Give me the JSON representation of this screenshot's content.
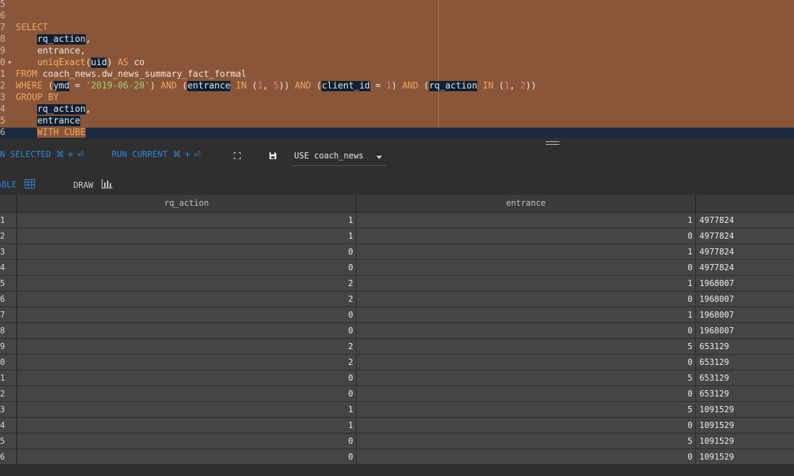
{
  "editor": {
    "line_numbers": [
      "5",
      "6",
      "7",
      "8",
      "9",
      "0",
      "1",
      "2",
      "3",
      "4",
      "5",
      "6"
    ],
    "sql": {
      "select": "SELECT",
      "col1": "rq_action",
      "col2": "entrance",
      "agg_fn": "uniqExact",
      "agg_arg": "uid",
      "as_kw": "AS",
      "alias": "co",
      "from_kw": "FROM",
      "table": "coach_news.dw_news_summary_fact_formal",
      "where_kw": "WHERE",
      "ymd": "ymd",
      "ymd_val": "'2019-06-20'",
      "and": "AND",
      "in": "IN",
      "entrance": "entrance",
      "client_id": "client_id",
      "rq_action": "rq_action",
      "n1": "1",
      "n2": "2",
      "n5": "5",
      "group_kw": "GROUP BY",
      "with_cube": "WITH CUBE"
    }
  },
  "toolbar": {
    "run_selected_label": "N SELECTED",
    "run_current_label": "RUN CURRENT",
    "shortcut": "⌘ + ⏎",
    "database_select": "USE coach_news"
  },
  "view_tabs": {
    "table_label": "TABLE",
    "draw_label": "DRAW"
  },
  "grid": {
    "columns": [
      "rq_action",
      "entrance",
      ""
    ],
    "rows": [
      {
        "idx": "1",
        "rq_action": "1",
        "entrance": "1",
        "count": "4977824"
      },
      {
        "idx": "2",
        "rq_action": "1",
        "entrance": "0",
        "count": "4977824"
      },
      {
        "idx": "3",
        "rq_action": "0",
        "entrance": "1",
        "count": "4977824"
      },
      {
        "idx": "4",
        "rq_action": "0",
        "entrance": "0",
        "count": "4977824"
      },
      {
        "idx": "5",
        "rq_action": "2",
        "entrance": "1",
        "count": "1968007"
      },
      {
        "idx": "6",
        "rq_action": "2",
        "entrance": "0",
        "count": "1968007"
      },
      {
        "idx": "7",
        "rq_action": "0",
        "entrance": "1",
        "count": "1968007"
      },
      {
        "idx": "8",
        "rq_action": "0",
        "entrance": "0",
        "count": "1968007"
      },
      {
        "idx": "9",
        "rq_action": "2",
        "entrance": "5",
        "count": "653129"
      },
      {
        "idx": "0",
        "rq_action": "2",
        "entrance": "0",
        "count": "653129"
      },
      {
        "idx": "1",
        "rq_action": "0",
        "entrance": "5",
        "count": "653129"
      },
      {
        "idx": "2",
        "rq_action": "0",
        "entrance": "0",
        "count": "653129"
      },
      {
        "idx": "3",
        "rq_action": "1",
        "entrance": "5",
        "count": "1091529"
      },
      {
        "idx": "4",
        "rq_action": "1",
        "entrance": "0",
        "count": "1091529"
      },
      {
        "idx": "5",
        "rq_action": "0",
        "entrance": "5",
        "count": "1091529"
      },
      {
        "idx": "6",
        "rq_action": "0",
        "entrance": "0",
        "count": "1091529"
      }
    ]
  },
  "colors": {
    "editor_selection": "#8a563a",
    "keyword": "#f0a45d",
    "accent_blue": "#2f86d8",
    "grid_row": "#454545"
  }
}
